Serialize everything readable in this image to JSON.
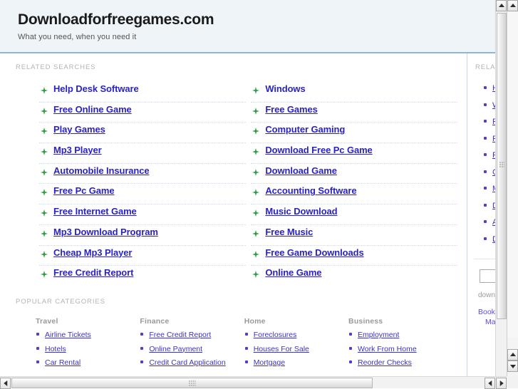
{
  "header": {
    "site_title": "Downloadforfreegames.com",
    "tagline": "What you need, when you need it"
  },
  "related_searches": {
    "label": "RELATED SEARCHES",
    "left_column": [
      "Help Desk Software",
      "Free Online Game",
      "Play Games",
      "Mp3 Player",
      "Automobile Insurance",
      "Free Pc Game",
      "Free Internet Game",
      "Mp3 Download Program",
      "Cheap Mp3 Player",
      "Free Credit Report"
    ],
    "right_column": [
      "Windows",
      "Free Games",
      "Computer Gaming",
      "Download Free Pc Game",
      "Download Game",
      "Accounting Software",
      "Music Download",
      "Free Music",
      "Free Game Downloads",
      "Online Game"
    ]
  },
  "popular_categories": {
    "label": "POPULAR CATEGORIES",
    "columns": [
      {
        "title": "Travel",
        "items": [
          "Airline Tickets",
          "Hotels",
          "Car Rental"
        ]
      },
      {
        "title": "Finance",
        "items": [
          "Free Credit Report",
          "Online Payment",
          "Credit Card Application"
        ]
      },
      {
        "title": "Home",
        "items": [
          "Foreclosures",
          "Houses For Sale",
          "Mortgage"
        ]
      },
      {
        "title": "Business",
        "items": [
          "Employment",
          "Work From Home",
          "Reorder Checks"
        ]
      }
    ]
  },
  "sidebar": {
    "label": "RELATED",
    "items": [
      "He",
      "Wi",
      "Fre",
      "Fre",
      "Pla",
      "Co",
      "Mp",
      "Do",
      "Au",
      "Do"
    ],
    "search_value": "",
    "search_placeholder": "",
    "domain_text": "downloadf",
    "footer_links": [
      "Bookmark",
      "Make thi"
    ]
  },
  "colors": {
    "header_bg": "#eef4f8",
    "header_rule": "#94b3d8",
    "link": "#2a22c9",
    "bullet_green": "#2f9e44",
    "bullet_purple": "#4e3fd0",
    "label_gray": "#b3b3b3",
    "divider": "#c8d7ea"
  }
}
